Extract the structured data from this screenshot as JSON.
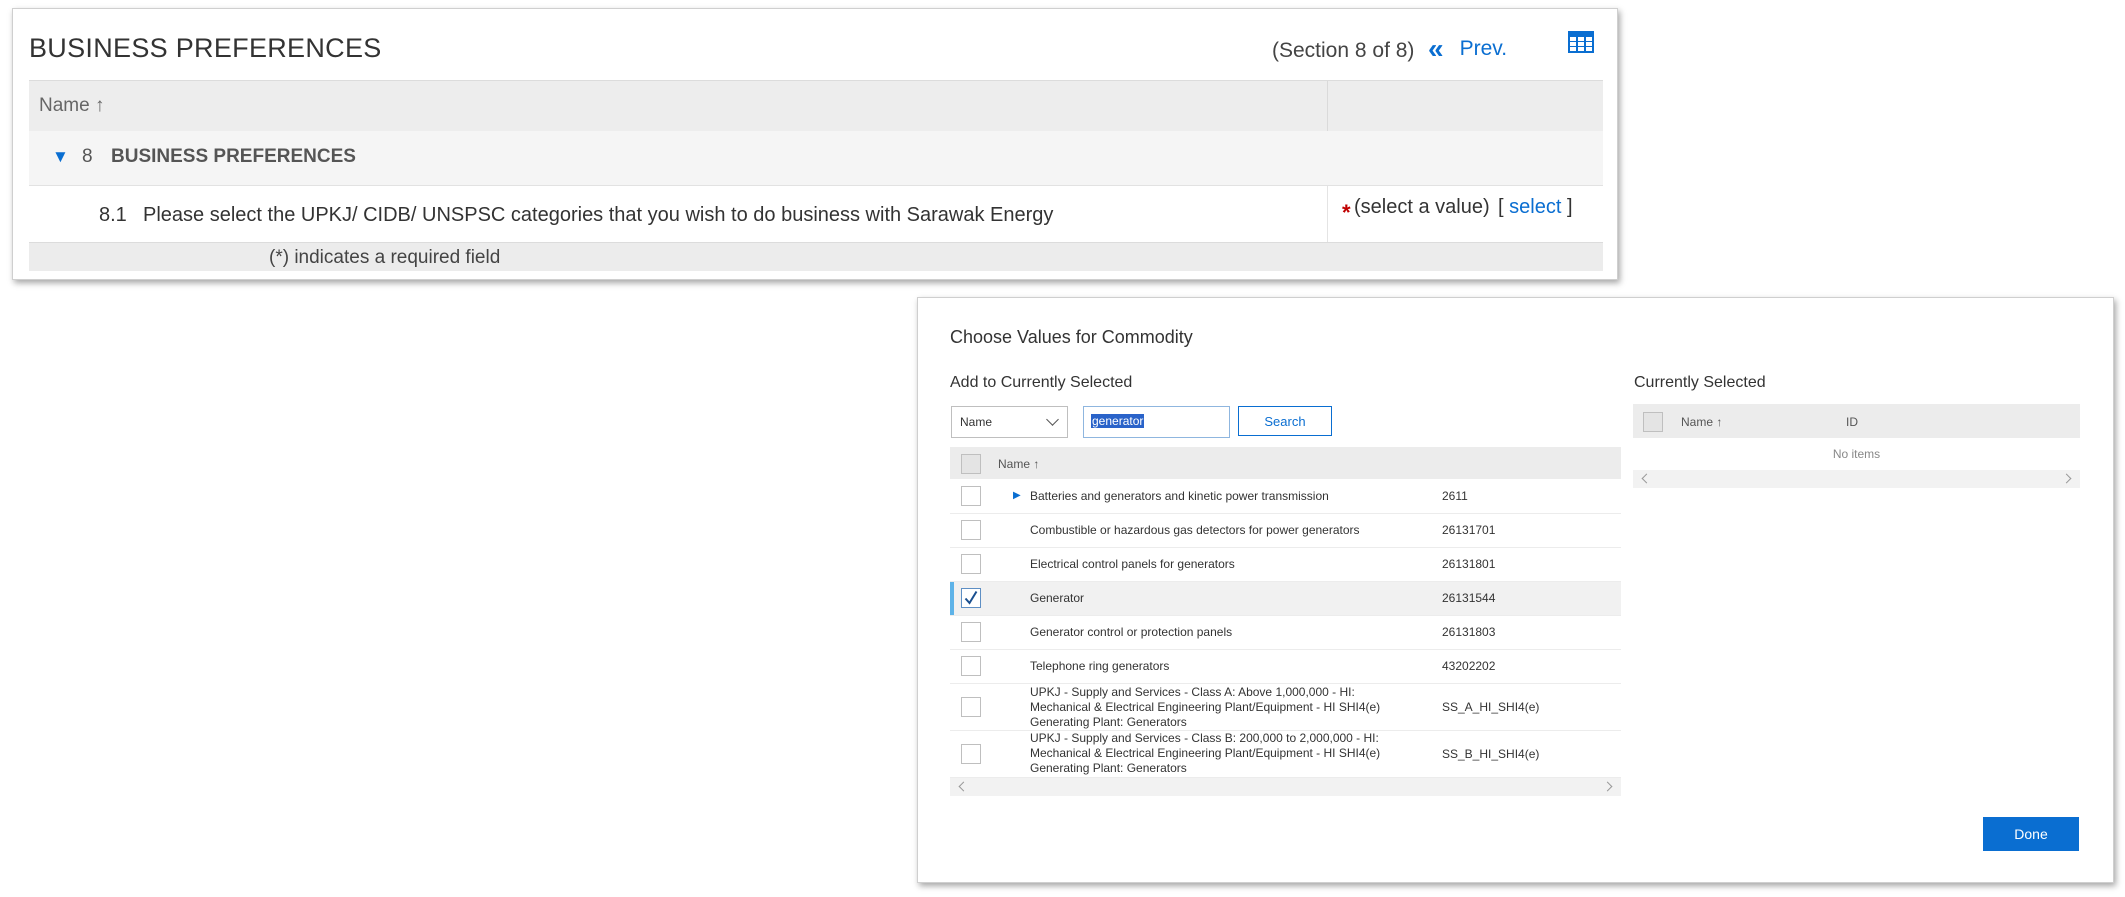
{
  "business_preferences": {
    "title": "BUSINESS PREFERENCES",
    "section_indicator": "(Section 8 of 8)",
    "prev_label": "Prev.",
    "table_header_name": "Name ↑",
    "group": {
      "number": "8",
      "title": "BUSINESS PREFERENCES"
    },
    "question": {
      "number": "8.1",
      "text": "Please select the UPKJ/ CIDB/ UNSPSC categories that you wish to do business with Sarawak Energy",
      "required_marker": "*",
      "value_placeholder": "(select a value)",
      "select_open": "[",
      "select_link": "select",
      "select_close": "]"
    },
    "required_note": "(*) indicates a required field"
  },
  "dialog": {
    "title": "Choose Values for Commodity",
    "add_section_label": "Add to Currently Selected",
    "selected_section_label": "Currently Selected",
    "search": {
      "field_option": "Name",
      "query": "generator",
      "button_label": "Search"
    },
    "results_header_name": "Name ↑",
    "results": [
      {
        "name": "Batteries and generators and kinetic power transmission",
        "id": "2611",
        "checked": false,
        "expandable": true
      },
      {
        "name": "Combustible or hazardous gas detectors for power generators",
        "id": "26131701",
        "checked": false
      },
      {
        "name": "Electrical control panels for generators",
        "id": "26131801",
        "checked": false
      },
      {
        "name": "Generator",
        "id": "26131544",
        "checked": true
      },
      {
        "name": "Generator control or protection panels",
        "id": "26131803",
        "checked": false
      },
      {
        "name": "Telephone ring generators",
        "id": "43202202",
        "checked": false
      },
      {
        "name_lines": [
          "UPKJ - Supply and Services - Class A: Above 1,000,000 - HI:",
          "Mechanical & Electrical Engineering Plant/Equipment - HI SHI4(e)",
          "Generating Plant: Generators"
        ],
        "id": "SS_A_HI_SHI4(e)",
        "checked": false
      },
      {
        "name_lines": [
          "UPKJ - Supply and Services - Class B: 200,000 to 2,000,000 - HI:",
          "Mechanical & Electrical Engineering Plant/Equipment - HI SHI4(e)",
          "Generating Plant: Generators"
        ],
        "id": "SS_B_HI_SHI4(e)",
        "checked": false
      }
    ],
    "selected_table": {
      "header_name": "Name ↑",
      "header_id": "ID",
      "empty_text": "No items"
    },
    "done_label": "Done"
  },
  "colors": {
    "accent": "#0a6ed1",
    "required": "#c00000",
    "selection_bar": "#5eb3e8"
  },
  "icons": [
    "double-chevron-left-icon",
    "table-grid-icon",
    "triangle-down-icon",
    "triangle-right-icon",
    "chevron-down-icon",
    "checkmark-icon",
    "scroll-left-icon",
    "scroll-right-icon"
  ]
}
